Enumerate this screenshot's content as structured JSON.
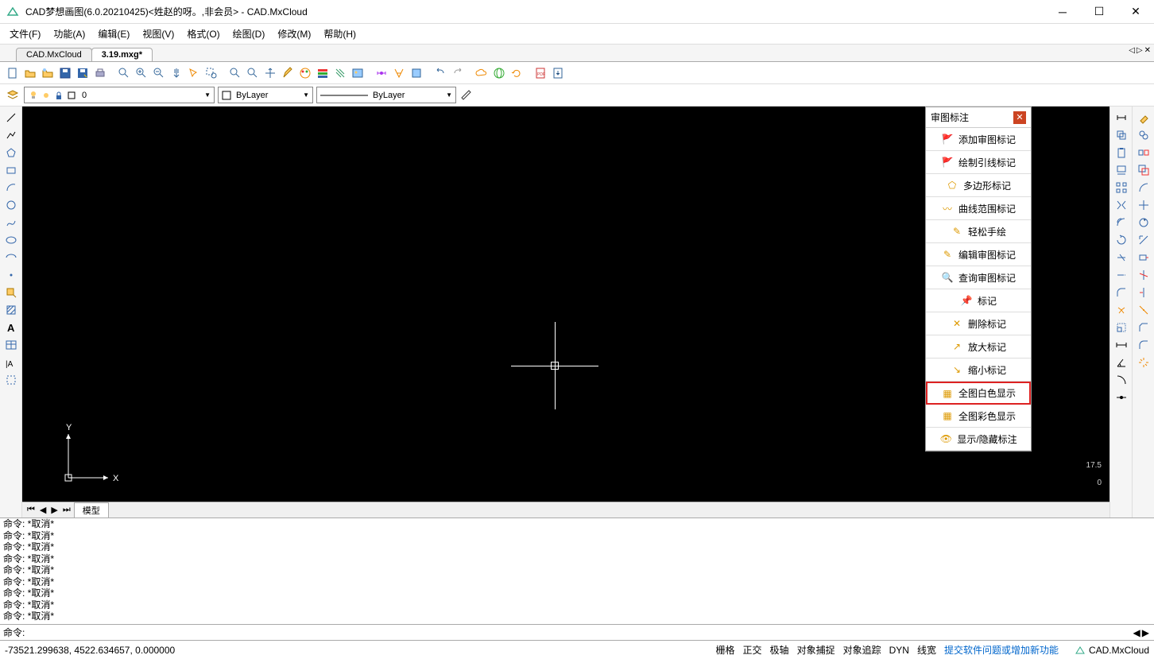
{
  "title": "CAD梦想画图(6.0.20210425)<姓赵的呀。,非会员> - CAD.MxCloud",
  "menu": [
    "文件(F)",
    "功能(A)",
    "编辑(E)",
    "视图(V)",
    "格式(O)",
    "绘图(D)",
    "修改(M)",
    "帮助(H)"
  ],
  "tabs": {
    "items": [
      "CAD.MxCloud",
      "3.19.mxg*"
    ],
    "activeIndex": 1
  },
  "layerCombo": {
    "value": "0"
  },
  "bylayer1": "ByLayer",
  "bylayer2": "ByLayer",
  "panel": {
    "title": "审图标注",
    "items": [
      "添加审图标记",
      "绘制引线标记",
      "多边形标记",
      "曲线范围标记",
      "轻松手绘",
      "编辑审图标记",
      "查询审图标记",
      "标记",
      "删除标记",
      "放大标记",
      "缩小标记",
      "全图白色显示",
      "全图彩色显示",
      "显示/隐藏标注"
    ],
    "highlightIndex": 11
  },
  "sheetTab": "模型",
  "cmdLogLines": [
    "命令:   *取消*",
    "命令:   *取消*",
    "命令:   *取消*",
    "命令:   *取消*",
    "命令:   *取消*",
    "命令:   *取消*",
    "命令:   *取消*",
    "命令:   *取消*",
    "命令:   *取消*"
  ],
  "cmdPrompt": "命令:",
  "status": {
    "coords": "-73521.299638,  4522.634657,  0.000000",
    "buttons": [
      "栅格",
      "正交",
      "极轴",
      "对象捕捉",
      "对象追踪",
      "DYN",
      "线宽"
    ],
    "link": "提交软件问题或增加新功能",
    "brand": "CAD.MxCloud"
  },
  "scaleLabels": {
    "max": "17.5",
    "min": "0"
  },
  "ucsLabels": {
    "y": "Y",
    "x": "X"
  }
}
